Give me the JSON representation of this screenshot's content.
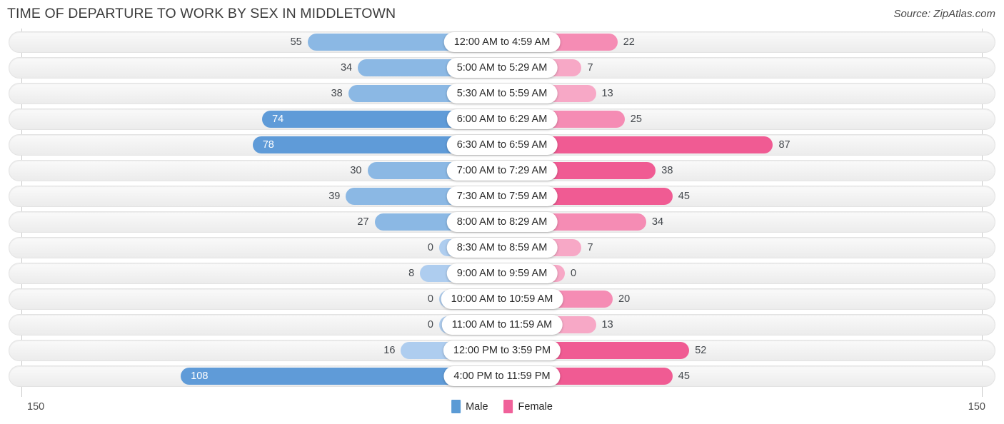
{
  "header": {
    "title": "TIME OF DEPARTURE TO WORK BY SEX IN MIDDLETOWN",
    "source": "Source: ZipAtlas.com"
  },
  "axis": {
    "left_label": "150",
    "right_label": "150",
    "max": 150
  },
  "legend": {
    "items": [
      {
        "label": "Male",
        "color": "#5b9bd5"
      },
      {
        "label": "Female",
        "color": "#f0619a"
      }
    ]
  },
  "colors": {
    "male_light": "#aecdef",
    "male_mid": "#8bb8e4",
    "male_strong": "#5f9bd8",
    "female_light": "#f7a8c6",
    "female_mid": "#f58cb4",
    "female_strong": "#f05b93"
  },
  "chart_data": {
    "type": "bar",
    "title": "TIME OF DEPARTURE TO WORK BY SEX IN MIDDLETOWN",
    "xlabel": "",
    "ylabel": "",
    "orientation": "horizontal-diverging",
    "xlim": [
      150,
      150
    ],
    "grid": false,
    "legend_position": "bottom-center",
    "categories": [
      "12:00 AM to 4:59 AM",
      "5:00 AM to 5:29 AM",
      "5:30 AM to 5:59 AM",
      "6:00 AM to 6:29 AM",
      "6:30 AM to 6:59 AM",
      "7:00 AM to 7:29 AM",
      "7:30 AM to 7:59 AM",
      "8:00 AM to 8:29 AM",
      "8:30 AM to 8:59 AM",
      "9:00 AM to 9:59 AM",
      "10:00 AM to 10:59 AM",
      "11:00 AM to 11:59 AM",
      "12:00 PM to 3:59 PM",
      "4:00 PM to 11:59 PM"
    ],
    "series": [
      {
        "name": "Male",
        "values": [
          55,
          34,
          38,
          74,
          78,
          30,
          39,
          27,
          0,
          8,
          0,
          0,
          16,
          108
        ]
      },
      {
        "name": "Female",
        "values": [
          22,
          7,
          13,
          25,
          87,
          38,
          45,
          34,
          7,
          0,
          20,
          13,
          52,
          45
        ]
      }
    ]
  },
  "rows": [
    {
      "label": "12:00 AM to 4:59 AM",
      "male": "55",
      "female": "22"
    },
    {
      "label": "5:00 AM to 5:29 AM",
      "male": "34",
      "female": "7"
    },
    {
      "label": "5:30 AM to 5:59 AM",
      "male": "38",
      "female": "13"
    },
    {
      "label": "6:00 AM to 6:29 AM",
      "male": "74",
      "female": "25"
    },
    {
      "label": "6:30 AM to 6:59 AM",
      "male": "78",
      "female": "87"
    },
    {
      "label": "7:00 AM to 7:29 AM",
      "male": "30",
      "female": "38"
    },
    {
      "label": "7:30 AM to 7:59 AM",
      "male": "39",
      "female": "45"
    },
    {
      "label": "8:00 AM to 8:29 AM",
      "male": "27",
      "female": "34"
    },
    {
      "label": "8:30 AM to 8:59 AM",
      "male": "0",
      "female": "7"
    },
    {
      "label": "9:00 AM to 9:59 AM",
      "male": "8",
      "female": "0"
    },
    {
      "label": "10:00 AM to 10:59 AM",
      "male": "0",
      "female": "20"
    },
    {
      "label": "11:00 AM to 11:59 AM",
      "male": "0",
      "female": "13"
    },
    {
      "label": "12:00 PM to 3:59 PM",
      "male": "16",
      "female": "52"
    },
    {
      "label": "4:00 PM to 11:59 PM",
      "male": "108",
      "female": "45"
    }
  ]
}
